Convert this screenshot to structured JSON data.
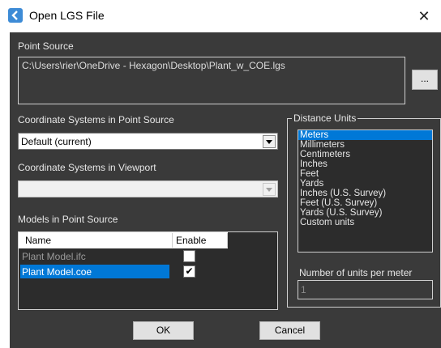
{
  "window": {
    "title": "Open LGS File",
    "close_glyph": "✕"
  },
  "point_source": {
    "label": "Point Source",
    "path": "C:\\Users\\rier\\OneDrive - Hexagon\\Desktop\\Plant_w_COE.lgs",
    "browse_label": "..."
  },
  "coord_point_source": {
    "label": "Coordinate Systems in Point Source",
    "value": "Default (current)"
  },
  "coord_viewport": {
    "label": "Coordinate Systems in Viewport",
    "value": ""
  },
  "models": {
    "label": "Models in Point Source",
    "col_name": "Name",
    "col_enable": "Enable",
    "rows": [
      {
        "name": "Plant Model.ifc",
        "check": "",
        "selected": false
      },
      {
        "name": "Plant Model.coe",
        "check": "✔",
        "selected": true
      }
    ]
  },
  "distance_units": {
    "label": "Distance Units",
    "items": [
      "Meters",
      "Millimeters",
      "Centimeters",
      "Inches",
      "Feet",
      "Yards",
      "Inches (U.S. Survey)",
      "Feet (U.S. Survey)",
      "Yards (U.S. Survey)",
      "Custom units"
    ],
    "selected_index": 0,
    "per_meter_label": "Number of units per meter",
    "per_meter_value": "1"
  },
  "buttons": {
    "ok": "OK",
    "cancel": "Cancel"
  },
  "colors": {
    "accent": "#0078d7",
    "client_bg": "#3a3a3a",
    "app_icon": "#3d8bd6"
  },
  "icons": {
    "app": "lgs-app-icon",
    "close": "close-icon",
    "dropdown": "chevron-down-icon",
    "check": "checkmark-icon"
  }
}
